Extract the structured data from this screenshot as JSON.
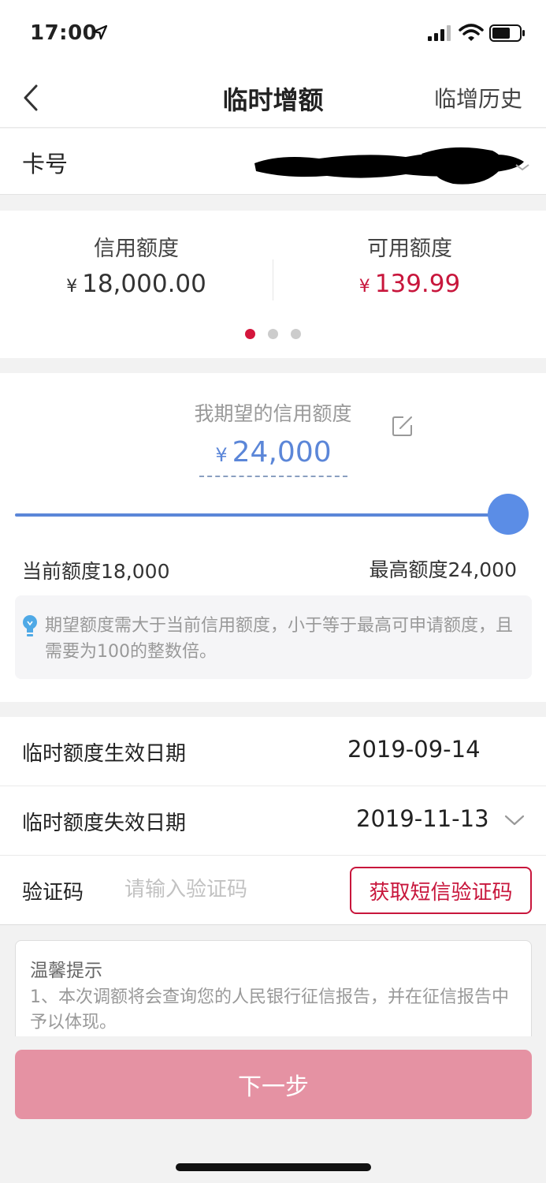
{
  "status": {
    "time": "17:00"
  },
  "nav": {
    "title": "临时增额",
    "right_label": "临增历史"
  },
  "card": {
    "label": "卡号"
  },
  "limits": {
    "currency": "¥",
    "credit_label": "信用额度",
    "credit_value": "18,000.00",
    "available_label": "可用额度",
    "available_value": "139.99",
    "carousel_pages": 3,
    "carousel_active": 1
  },
  "expect": {
    "label": "我期望的信用额度",
    "currency": "¥",
    "value": "24,000",
    "slider_fraction": 1.0,
    "min_label": "当前额度18,000",
    "max_label": "最高额度24,000",
    "tip": "期望额度需大于当前信用额度，小于等于最高可申请额度，且需要为100的整数倍。"
  },
  "form": {
    "effective_label": "临时额度生效日期",
    "effective_value": "2019-09-14",
    "expiry_label": "临时额度失效日期",
    "expiry_value": "2019-11-13",
    "code_label": "验证码",
    "code_value": "",
    "code_placeholder": "请输入验证码",
    "sms_button": "获取短信验证码"
  },
  "notice": {
    "title": "温馨提示",
    "text": "1、本次调额将会查询您的人民银行征信报告，并在征信报告中予以体现。"
  },
  "next_button": "下一步",
  "colors": {
    "brand_red": "#c8163c",
    "slider_blue": "#5b86d8",
    "next_button_bg": "#e592a3"
  }
}
